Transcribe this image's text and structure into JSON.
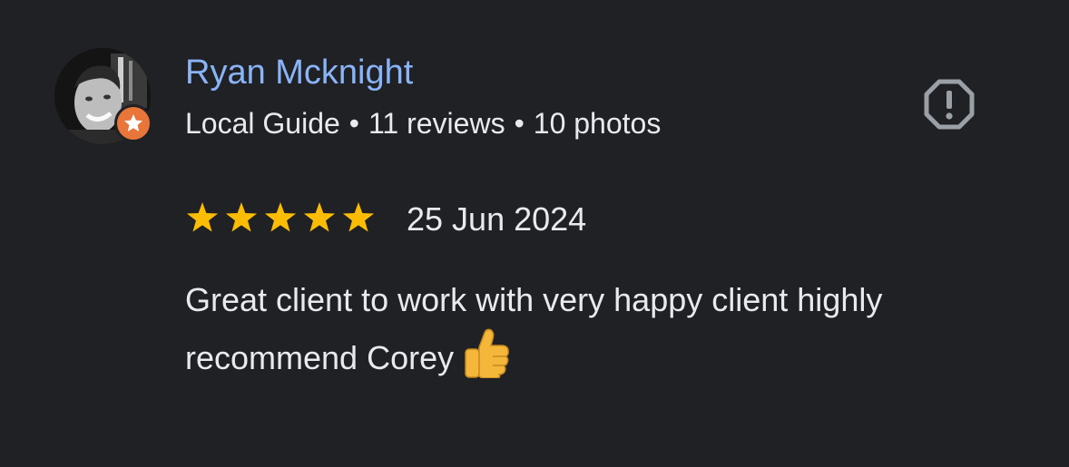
{
  "review": {
    "author": {
      "name": "Ryan Mcknight",
      "level": "Local Guide",
      "reviews": "11 reviews",
      "photos": "10 photos",
      "separator": "•"
    },
    "rating": 5,
    "rating_max": 5,
    "date": "25 Jun 2024",
    "text": "Great client to work with very happy client highly recommend Corey",
    "emoji": "thumbs-up"
  },
  "icons": {
    "report": "report-flag-icon",
    "badge": "local-guide-star-icon"
  },
  "colors": {
    "background": "#202124",
    "name": "#8ab4f8",
    "text": "#e8eaed",
    "star": "#fbbc04",
    "badge": "#e8753a",
    "report_icon": "#9aa0a6"
  }
}
